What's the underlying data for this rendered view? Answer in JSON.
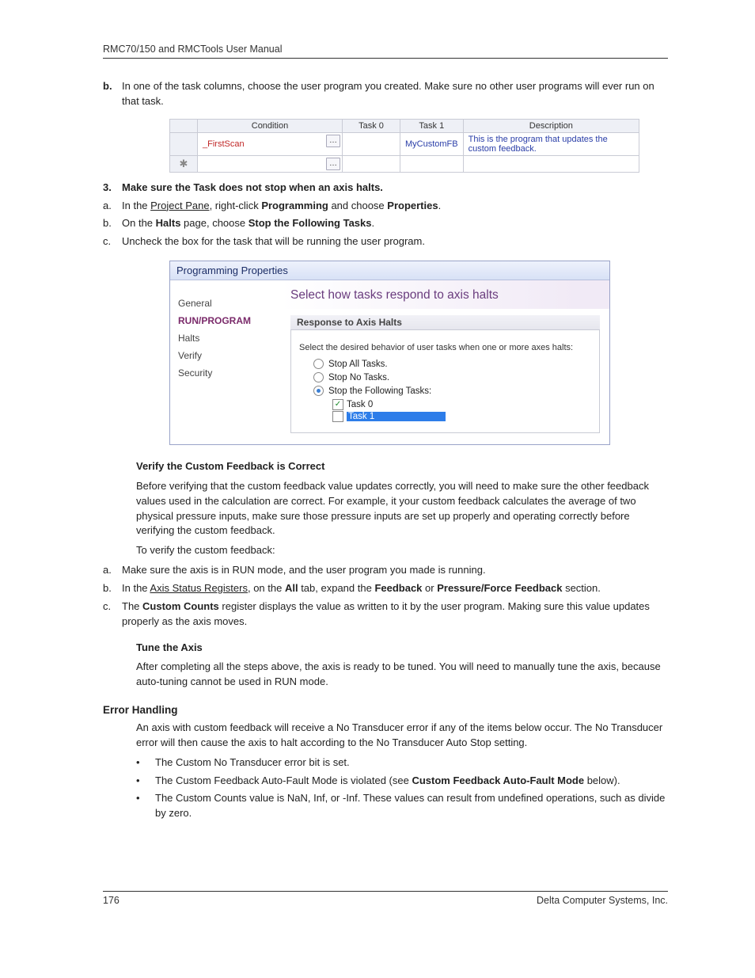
{
  "header": "RMC70/150 and RMCTools User Manual",
  "step_b_marker": "b.",
  "step_b_text": "In one of the task columns, choose the user program you created. Make sure no other user programs will ever run on that task.",
  "table1": {
    "headers": {
      "lcol": "",
      "condition": "Condition",
      "task0": "Task 0",
      "task1": "Task 1",
      "description": "Description"
    },
    "rows": [
      {
        "lcol": "",
        "condition": "_FirstScan",
        "task0": "",
        "task1": "MyCustomFB",
        "description": "This is the program that updates the custom feedback."
      },
      {
        "lcol": "✱",
        "condition": "",
        "task0": "",
        "task1": "",
        "description": ""
      }
    ]
  },
  "step3_marker": "3.",
  "step3_text": "Make sure the Task does not stop when an axis halts.",
  "step3a_marker": "a.",
  "step3a_prefix": "In the ",
  "step3a_link": "Project Pane",
  "step3a_mid": ", right-click ",
  "step3a_bold1": "Programming",
  "step3a_mid2": " and choose ",
  "step3a_bold2": "Properties",
  "step3a_suffix": ".",
  "step3b_marker": "b.",
  "step3b_prefix": "On the ",
  "step3b_bold1": "Halts",
  "step3b_mid": " page, choose ",
  "step3b_bold2": "Stop the Following Tasks",
  "step3b_suffix": ".",
  "step3c_marker": "c.",
  "step3c_text": "Uncheck the box for the task that will be running the user program.",
  "dialog": {
    "title": "Programming Properties",
    "nav": [
      "General",
      "RUN/PROGRAM",
      "Halts",
      "Verify",
      "Security"
    ],
    "main_title": "Select how tasks respond to axis halts",
    "group_legend": "Response to Axis Halts",
    "group_intro": "Select the desired behavior of user tasks when one or more axes halts:",
    "radio1": "Stop All Tasks.",
    "radio2": "Stop No Tasks.",
    "radio3": "Stop the Following Tasks:",
    "check1": "Task 0",
    "check2": "Task 1"
  },
  "verify_heading": "Verify the Custom Feedback is Correct",
  "verify_p1": "Before verifying that the custom feedback value updates correctly, you will need to make sure the other feedback values used in the calculation are correct. For example, it your custom feedback calculates the average of two physical pressure inputs, make sure those pressure inputs are set up properly and operating correctly before verifying the custom feedback.",
  "verify_p2": "To verify the custom feedback:",
  "va_marker": "a.",
  "va_text": "Make sure the axis is in RUN mode, and the user program you made is running.",
  "vb_marker": "b.",
  "vb_prefix": "In the ",
  "vb_link": "Axis Status Registers",
  "vb_mid": ", on the ",
  "vb_bold1": "All",
  "vb_mid2": " tab, expand the ",
  "vb_bold2": "Feedback",
  "vb_mid3": " or ",
  "vb_bold3": "Pressure/Force Feedback",
  "vb_suffix": " section.",
  "vc_marker": "c.",
  "vc_prefix": "The ",
  "vc_bold": "Custom Counts",
  "vc_suffix": " register displays the value as written to it by the user program. Making sure this value updates properly as the axis moves.",
  "tune_heading": "Tune the Axis",
  "tune_p": "After completing all the steps above, the axis is ready to be tuned. You will need to manually tune the axis, because auto-tuning cannot be used in RUN mode.",
  "error_heading": "Error Handling",
  "error_p": "An axis with custom feedback will receive a No Transducer error if any of the items below occur. The No Transducer error will then cause the axis to halt according to the No Transducer Auto Stop setting.",
  "bullet1": "The Custom No Transducer error bit is set.",
  "bullet2_prefix": "The Custom Feedback Auto-Fault Mode is violated (see ",
  "bullet2_bold": "Custom Feedback Auto-Fault Mode",
  "bullet2_suffix": " below).",
  "bullet3": "The Custom Counts value is NaN, Inf, or -Inf. These values can result from undefined operations, such as divide by zero.",
  "bullet_marker": "•",
  "footer_left": "176",
  "footer_right": "Delta Computer Systems, Inc."
}
